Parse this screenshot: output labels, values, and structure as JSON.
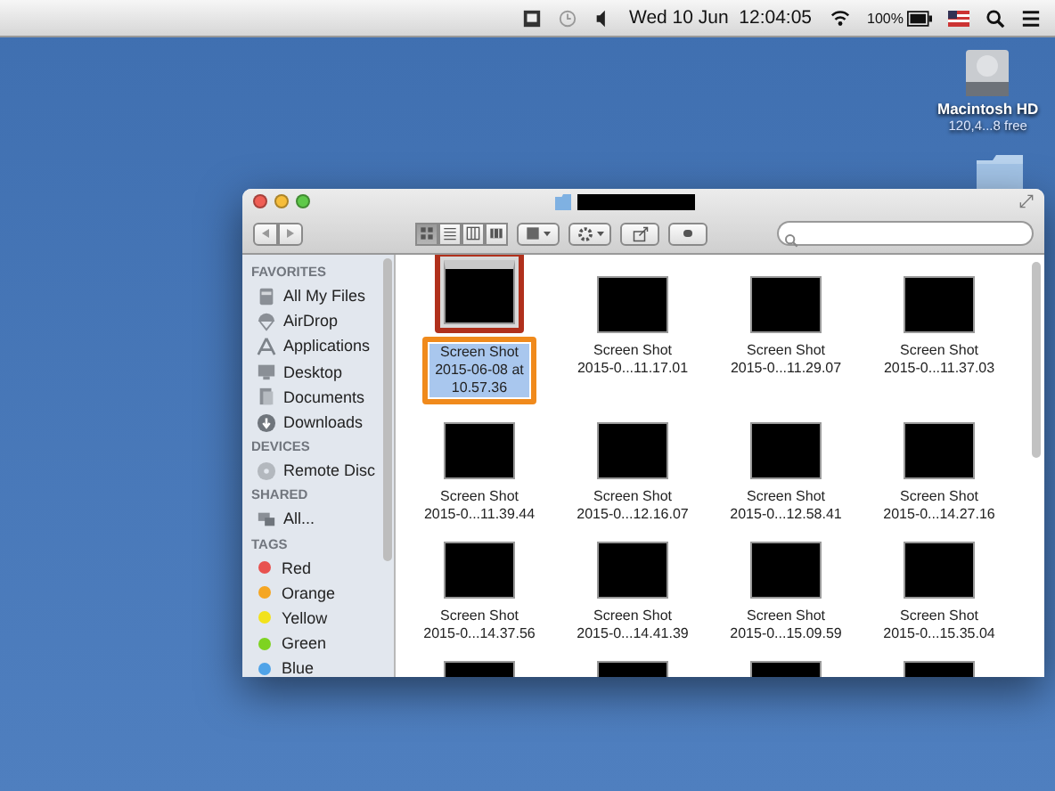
{
  "menu_bar": {
    "clock": "Wed 10 Jun  12:04:05",
    "battery": "100%"
  },
  "desktop_items": [
    {
      "kind": "disk",
      "name": "Macintosh HD",
      "detail": "120,4...8 free"
    },
    {
      "kind": "folder"
    }
  ],
  "window": {
    "view_modes": [
      {
        "kind": "icons",
        "selected": true
      },
      {
        "kind": "list",
        "selected": false
      },
      {
        "kind": "columns",
        "selected": false
      },
      {
        "kind": "coverflow",
        "selected": false
      }
    ]
  },
  "sidebar": [
    {
      "heading": "FAVORITES",
      "items": [
        {
          "kind": "files",
          "label": "All My Files"
        },
        {
          "kind": "airdrop",
          "label": "AirDrop"
        },
        {
          "kind": "apps",
          "label": "Applications"
        },
        {
          "kind": "desktop",
          "label": "Desktop"
        },
        {
          "kind": "documents",
          "label": "Documents"
        },
        {
          "kind": "downloads",
          "label": "Downloads"
        }
      ]
    },
    {
      "heading": "DEVICES",
      "items": [
        {
          "kind": "disc",
          "label": "Remote Disc"
        }
      ]
    },
    {
      "heading": "SHARED",
      "items": [
        {
          "kind": "network",
          "label": "All..."
        }
      ]
    },
    {
      "heading": "TAGS",
      "items": [
        {
          "kind": "tag",
          "label": "Red",
          "color": "#e8524f"
        },
        {
          "kind": "tag",
          "label": "Orange",
          "color": "#f5a623"
        },
        {
          "kind": "tag",
          "label": "Yellow",
          "color": "#f2e21c"
        },
        {
          "kind": "tag",
          "label": "Green",
          "color": "#7ed321"
        },
        {
          "kind": "tag",
          "label": "Blue",
          "color": "#4fa3e8"
        }
      ]
    }
  ],
  "files": [
    {
      "name": "Screen Shot 2015-06-08 at 10.57.36",
      "selected": true,
      "highlighted": true
    },
    {
      "name": "Screen Shot 2015-0...11.17.01",
      "selected": false,
      "highlighted": false
    },
    {
      "name": "Screen Shot 2015-0...11.29.07",
      "selected": false,
      "highlighted": false
    },
    {
      "name": "Screen Shot 2015-0...11.37.03",
      "selected": false,
      "highlighted": false
    },
    {
      "name": "Screen Shot 2015-0...11.39.44",
      "selected": false,
      "highlighted": false
    },
    {
      "name": "Screen Shot 2015-0...12.16.07",
      "selected": false,
      "highlighted": false
    },
    {
      "name": "Screen Shot 2015-0...12.58.41",
      "selected": false,
      "highlighted": false
    },
    {
      "name": "Screen Shot 2015-0...14.27.16",
      "selected": false,
      "highlighted": false
    },
    {
      "name": "Screen Shot 2015-0...14.37.56",
      "selected": false,
      "highlighted": false
    },
    {
      "name": "Screen Shot 2015-0...14.41.39",
      "selected": false,
      "highlighted": false
    },
    {
      "name": "Screen Shot 2015-0...15.09.59",
      "selected": false,
      "highlighted": false
    },
    {
      "name": "Screen Shot 2015-0...15.35.04",
      "selected": false,
      "highlighted": false
    },
    {
      "selected": false,
      "highlighted": false
    },
    {
      "selected": false,
      "highlighted": false
    },
    {
      "selected": false,
      "highlighted": false
    },
    {
      "selected": false,
      "highlighted": false
    }
  ]
}
